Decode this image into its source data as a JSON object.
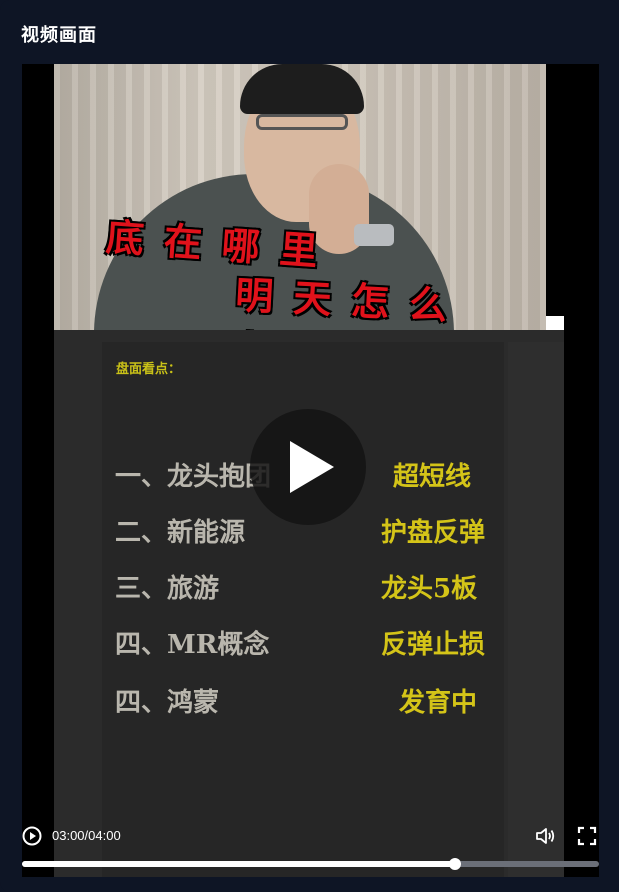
{
  "panel": {
    "title": "视频画面"
  },
  "video": {
    "overlay_line1": "底在哪里",
    "overlay_line2": "明天怎么办？",
    "board_title": "盘面看点：",
    "rows": [
      {
        "left": "一、龙头抱团",
        "right": "超短线"
      },
      {
        "left": "二、新能源",
        "right": "护盘反弹"
      },
      {
        "left": "三、旅游",
        "right": "龙头5板"
      },
      {
        "left": "四、MR概念",
        "right": "反弹止损"
      },
      {
        "left": "四、鸿蒙",
        "right": "发育中"
      }
    ]
  },
  "player": {
    "time_display": "03:00/04:00",
    "progress_fraction": 0.75,
    "icons": [
      "play-icon",
      "volume-icon",
      "fullscreen-icon",
      "big-play-icon"
    ]
  }
}
